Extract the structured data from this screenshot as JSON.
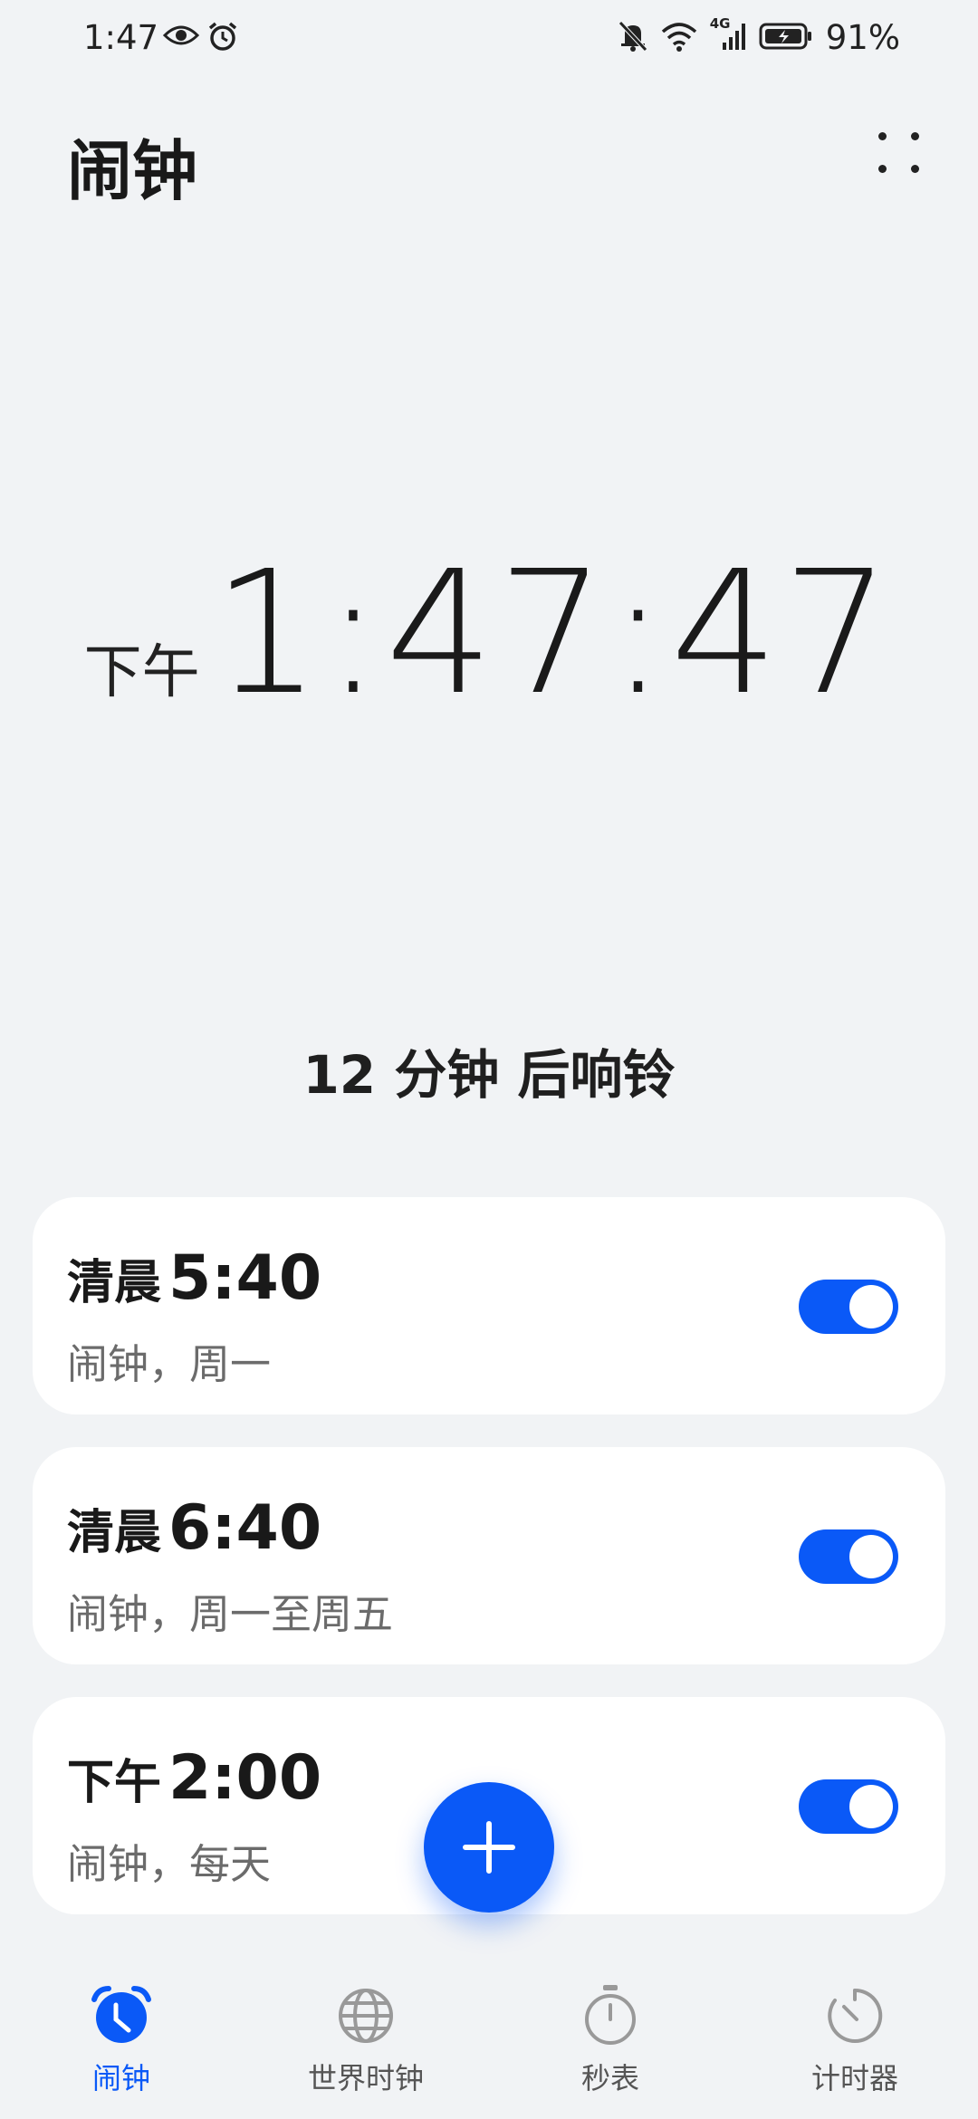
{
  "status_bar": {
    "time": "1:47",
    "network": "4G",
    "battery": "91%"
  },
  "header": {
    "title": "闹钟"
  },
  "clock": {
    "ampm": "下午",
    "time": "1:47:47"
  },
  "next_alarm": "12 分钟 后响铃",
  "alarms": [
    {
      "period": "清晨",
      "time": "5:40",
      "subtitle": "闹钟，周一",
      "enabled": true
    },
    {
      "period": "清晨",
      "time": "6:40",
      "subtitle": "闹钟，周一至周五",
      "enabled": true
    },
    {
      "period": "下午",
      "time": "2:00",
      "subtitle": "闹钟，每天",
      "enabled": true
    }
  ],
  "nav": {
    "items": [
      {
        "label": "闹钟",
        "icon": "alarm-clock-icon",
        "active": true
      },
      {
        "label": "世界时钟",
        "icon": "globe-icon",
        "active": false
      },
      {
        "label": "秒表",
        "icon": "stopwatch-icon",
        "active": false
      },
      {
        "label": "计时器",
        "icon": "timer-icon",
        "active": false
      }
    ]
  },
  "colors": {
    "accent": "#0a59f7",
    "background": "#f1f3f5",
    "card": "#ffffff"
  }
}
